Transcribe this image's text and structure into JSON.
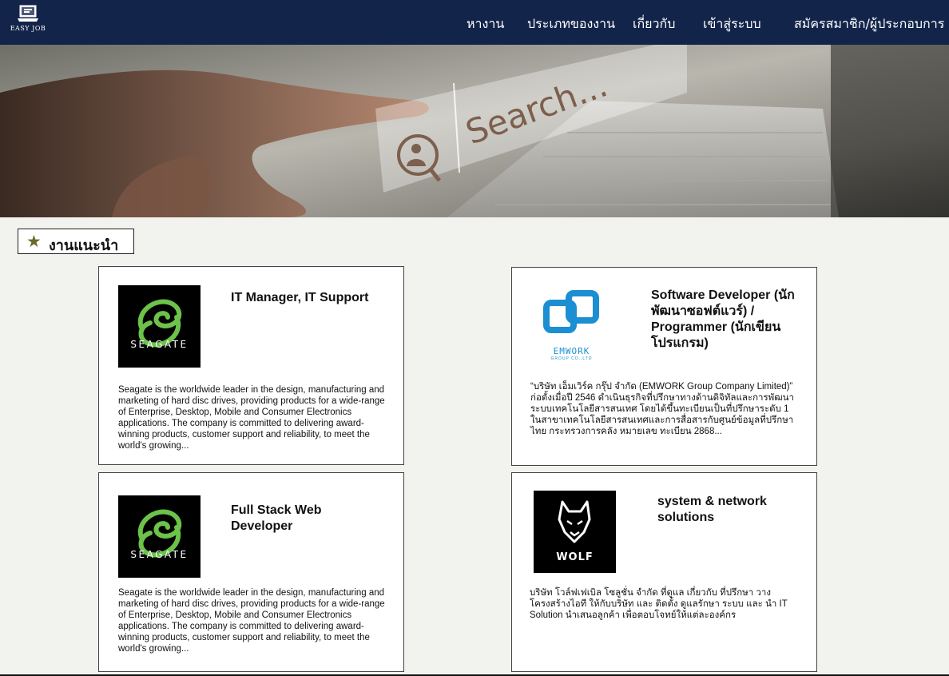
{
  "brand": {
    "name": "EASY JOB"
  },
  "nav": {
    "items": [
      {
        "label": "หางาน"
      },
      {
        "label": "ประเภทของงาน"
      },
      {
        "label": "เกี่ยวกับ"
      },
      {
        "label": "เข้าสู่ระบบ"
      },
      {
        "label": "สมัครสมาชิก/ผู้ประกอบการ"
      }
    ]
  },
  "hero": {
    "search_text": "Search..."
  },
  "section": {
    "title": "งานแนะนำ",
    "icon": "star-icon"
  },
  "jobs": [
    {
      "title": "IT Manager, IT Support",
      "company_logo": "SEAGATE",
      "description": "Seagate is the worldwide leader in the design, manufacturing and marketing of hard disc drives, providing products for a wide-range of Enterprise, Desktop, Mobile and Consumer Electronics applications. The company is committed to delivering award-winning products, customer support and reliability, to meet the world's growing..."
    },
    {
      "title": "Software Developer (นักพัฒนาซอฟต์แวร์) / Programmer (นักเขียนโปรแกรม)",
      "company_logo": "EMWORK",
      "company_logo_sub": "GROUP CO.,LTD",
      "description": "“บริษัท เอ็มเวิร์ค กรุ๊ป จำกัด (EMWORK Group Company Limited)” ก่อตั้งเมื่อปี 2546 ดำเนินธุรกิจที่ปรึกษาทางด้านดิจิทัลและการพัฒนาระบบเทคโนโลยีสารสนเทศ โดยได้ขึ้นทะเบียนเป็นที่ปรึกษาระดับ 1 ในสาขาเทคโนโลยีสารสนเทศและการสื่อสารกับศูนย์ข้อมูลที่ปรึกษาไทย กระทรวงการคลัง หมายเลข ทะเบียน 2868..."
    },
    {
      "title": "Full Stack  Web Developer",
      "company_logo": "SEAGATE",
      "description": "Seagate is the worldwide leader in the design, manufacturing and marketing of hard disc drives, providing products for a wide-range of Enterprise, Desktop, Mobile and Consumer Electronics applications. The company is committed to delivering award-winning products, customer support and reliability, to meet the world's growing..."
    },
    {
      "title": "system & network solutions",
      "company_logo": "WOLF",
      "description": "บริษัท โวล์ฟเฟเบิล โซลูชั่น จำกัด ที่ดูแล เกี่ยวกับ ที่ปรึกษา วางโครงสร้างไอที ให้กับบริษัท และ ติดตั้ง ดูแลรักษา ระบบ และ นำ IT Solution นำเสนอลูกค้า เพื่อตอบโจทย์ให้แต่ละองค์กร"
    }
  ],
  "colors": {
    "navbar": "#13244a",
    "page_bg": "#f2f2ee",
    "seagate_green": "#6cc24a",
    "emwork_blue": "#1b8fd1",
    "star": "#6b6a2a"
  }
}
